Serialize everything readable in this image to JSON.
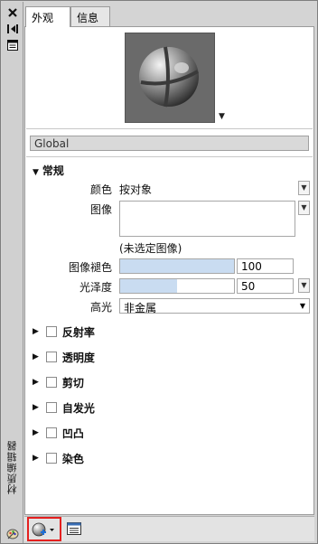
{
  "window": {
    "vertical_title": "材质编辑器"
  },
  "tabs": [
    {
      "label": "外观",
      "active": true
    },
    {
      "label": "信息",
      "active": false
    }
  ],
  "material": {
    "name": "Global"
  },
  "sections": {
    "general": {
      "title": "常规",
      "expanded": true,
      "color_label": "颜色",
      "color_value": "按对象",
      "image_label": "图像",
      "image_caption": "(未选定图像)",
      "image_fade_label": "图像褪色",
      "image_fade_value": "100",
      "image_fade_level": 1.0,
      "glossiness_label": "光泽度",
      "glossiness_value": "50",
      "glossiness_level": 0.5,
      "highlight_label": "高光",
      "highlight_value": "非金属"
    },
    "collapsed": [
      {
        "label": "反射率",
        "checked": false
      },
      {
        "label": "透明度",
        "checked": false
      },
      {
        "label": "剪切",
        "checked": false
      },
      {
        "label": "自发光",
        "checked": false
      },
      {
        "label": "凹凸",
        "checked": false
      },
      {
        "label": "染色",
        "checked": false
      }
    ]
  },
  "colors": {
    "accent_highlight": "#e4201f",
    "slider_fill": "#c9dcf1",
    "create_icon_plus": "#1f6fd6"
  },
  "icons": {
    "close": "close-icon",
    "auto_hide": "auto-hide-icon",
    "properties": "properties-icon",
    "material_preview": "material-sphere-icon",
    "create_material": "create-material-icon",
    "material_browser": "material-browser-icon",
    "palette": "palette-icon"
  }
}
